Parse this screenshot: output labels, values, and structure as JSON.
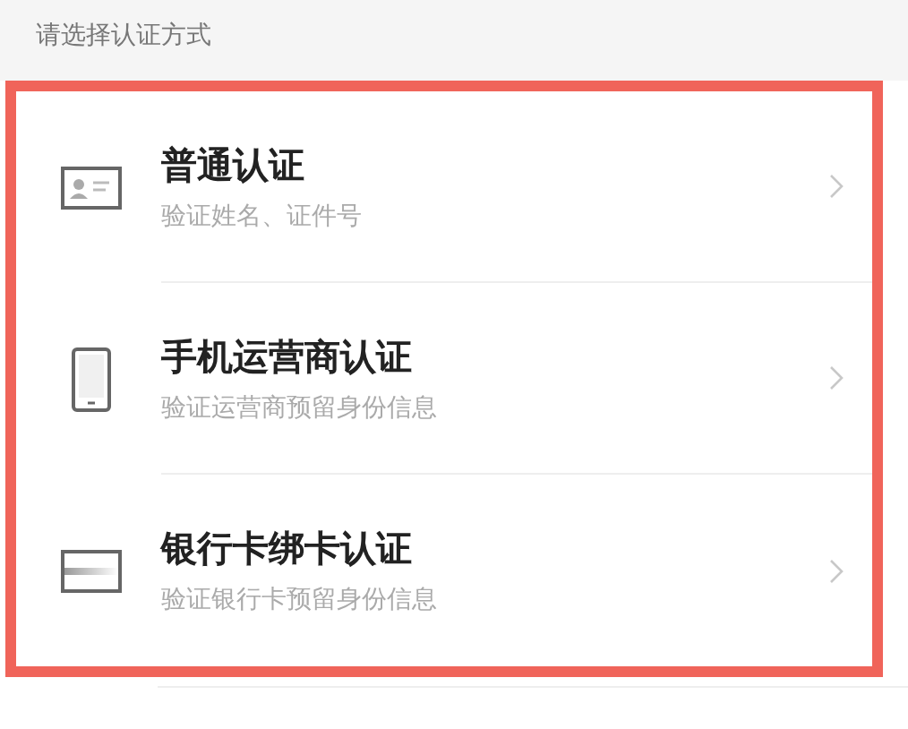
{
  "section_title": "请选择认证方式",
  "methods": [
    {
      "kind": "id-card",
      "title": "普通认证",
      "subtitle": "验证姓名、证件号"
    },
    {
      "kind": "phone",
      "title": "手机运营商认证",
      "subtitle": "验证运营商预留身份信息"
    },
    {
      "kind": "bank-card",
      "title": "银行卡绑卡认证",
      "subtitle": "验证银行卡预留身份信息"
    }
  ]
}
